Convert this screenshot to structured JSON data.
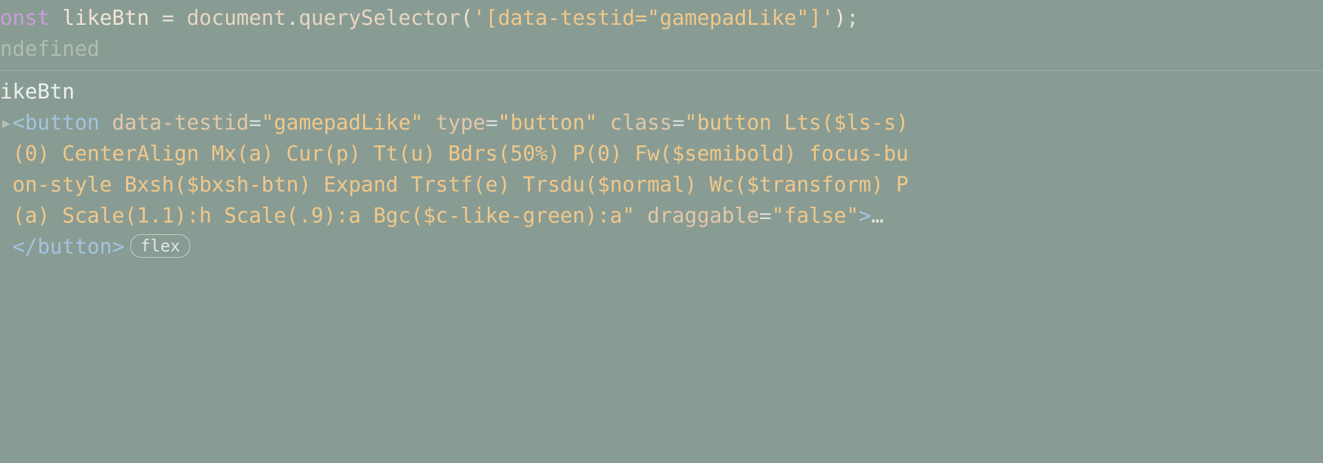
{
  "entry1": {
    "kw_const": "onst ",
    "varname": "likeBtn",
    "eq": " = ",
    "obj": "document",
    "dot": ".",
    "method": "querySelector",
    "lparen": "(",
    "arg": "'[data-testid=\"gamepadLike\"]'",
    "rparen": ")",
    "semi": ";",
    "result": "ndefined"
  },
  "entry2": {
    "input": "ikeBtn",
    "caret": "▸",
    "open_bracket": "<",
    "tagname": "button",
    "attr1_name": " data-testid",
    "attr1_eq": "=",
    "attr1_val": "\"gamepadLike\"",
    "attr2_name": " type",
    "attr2_eq": "=",
    "attr2_val": "\"button\"",
    "attr3_name": " class",
    "attr3_eq": "=",
    "class_open": "\"",
    "class_l1_tail": "button Lts($ls-s) ",
    "class_l2": "(0) CenterAlign Mx(a) Cur(p) Tt(u) Bdrs(50%) P(0) Fw($semibold) focus-bu",
    "class_l3": "on-style Bxsh($bxsh-btn) Expand Trstf(e) Trsdu($normal) Wc($transform) P",
    "class_l4": "(a) Scale(1.1):h Scale(.9):a Bgc($c-like-green):a",
    "class_close": "\"",
    "attr4_name": " draggable",
    "attr4_eq": "=",
    "attr4_val": "\"false\"",
    "gt": ">",
    "ellipsis": "…",
    "close_open": "</",
    "close_name": "button",
    "close_gt": ">",
    "badge": "flex"
  }
}
